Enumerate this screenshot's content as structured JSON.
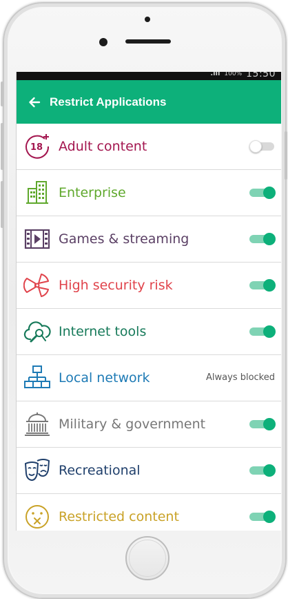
{
  "status_bar": {
    "signal": ".ıll",
    "battery": "100%",
    "time": "15:50"
  },
  "app_bar": {
    "title": "Restrict Applications"
  },
  "rows": [
    {
      "label": "Adult content",
      "icon": "adult-18-icon",
      "color": "#a3164f",
      "state": "off"
    },
    {
      "label": "Enterprise",
      "icon": "enterprise-building-icon",
      "color": "#5fa82c",
      "state": "on"
    },
    {
      "label": "Games & streaming",
      "icon": "games-streaming-icon",
      "color": "#5a3f64",
      "state": "on"
    },
    {
      "label": "High security risk",
      "icon": "radiation-icon",
      "color": "#e0434b",
      "state": "on"
    },
    {
      "label": "Internet tools",
      "icon": "cloud-tools-icon",
      "color": "#177a5a",
      "state": "on"
    },
    {
      "label": "Local network",
      "icon": "network-icon",
      "color": "#1d7ab5",
      "state": "always_blocked",
      "status_text": "Always blocked"
    },
    {
      "label": "Military & government",
      "icon": "government-building-icon",
      "color": "#777777",
      "state": "on"
    },
    {
      "label": "Recreational",
      "icon": "theater-masks-icon",
      "color": "#1f3f6b",
      "state": "on"
    },
    {
      "label": "Restricted content",
      "icon": "restricted-face-icon",
      "color": "#c9a227",
      "state": "on"
    }
  ],
  "colors": {
    "accent": "#0db07a",
    "toggle_on_track": "#7fd3b4",
    "divider": "#dadada"
  }
}
